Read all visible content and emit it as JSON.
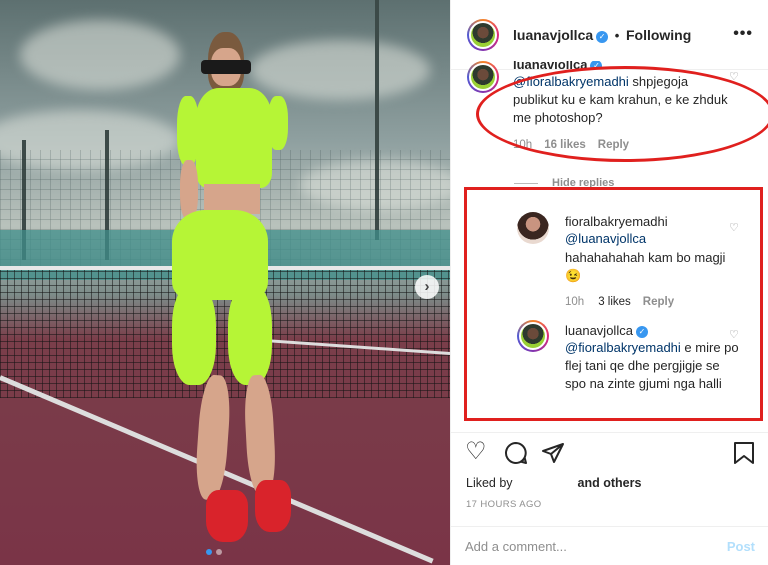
{
  "header": {
    "username": "luanavjollca",
    "separator": "•",
    "follow_status": "Following",
    "more_label": "•••"
  },
  "comments": [
    {
      "username": "luanavjollca",
      "mention": "@fioralbakryemadhi",
      "text": " shpjegoja publikut ku e kam krahun, e ke zhduk me photoshop?",
      "time": "10h",
      "likes": "16 likes",
      "reply_label": "Reply",
      "hide_replies_label": "Hide replies"
    },
    {
      "username": "fioralbakryemadhi",
      "mention": "@luanavjollca",
      "text": "hahahahahah kam bo magji 😉",
      "time": "10h",
      "likes": "3 likes",
      "reply_label": "Reply"
    },
    {
      "username": "luanavjollca",
      "mention": "@fioralbakryemadhi",
      "text": " e mire po flej tani qe dhe pergjigje se spo na zinte gjumi nga halli",
      "time": "",
      "likes": "",
      "reply_label": ""
    }
  ],
  "actions": {
    "icons": [
      "heart-icon",
      "comment-icon",
      "share-icon",
      "bookmark-icon"
    ]
  },
  "likes_info": {
    "prefix": "Liked by",
    "suffix": "and others"
  },
  "timestamp": "17 HOURS AGO",
  "add_comment": {
    "placeholder": "Add a comment...",
    "post_label": "Post"
  },
  "carousel": {
    "next_label": "›",
    "total": 2,
    "active": 1
  },
  "colors": {
    "link": "#003569",
    "muted": "#8e8e8e",
    "annotation_red": "#e0201e",
    "post_disabled": "#b2dffc",
    "verified": "#3897f0"
  }
}
